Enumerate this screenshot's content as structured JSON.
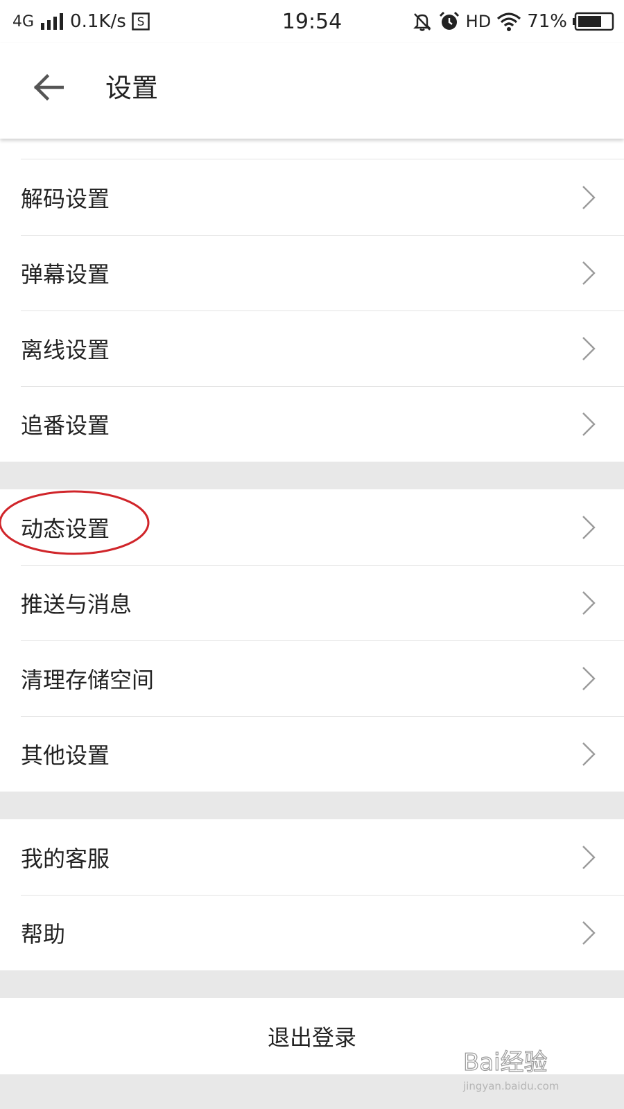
{
  "status_bar": {
    "network": "4G",
    "speed": "0.1K/s",
    "app_badge": "S",
    "time": "19:54",
    "hd": "HD",
    "battery": "71%",
    "battery_level": 0.71
  },
  "header": {
    "title": "设置",
    "back_icon": "arrow-left-icon"
  },
  "settings": {
    "group1": [
      {
        "label": "解码设置"
      },
      {
        "label": "弹幕设置"
      },
      {
        "label": "离线设置"
      },
      {
        "label": "追番设置"
      }
    ],
    "group2": [
      {
        "label": "动态设置"
      },
      {
        "label": "推送与消息"
      },
      {
        "label": "清理存储空间"
      },
      {
        "label": "其他设置"
      }
    ],
    "group3": [
      {
        "label": "我的客服"
      },
      {
        "label": "帮助"
      }
    ],
    "logout_label": "退出登录"
  },
  "watermark": {
    "brand": "Bai经验",
    "url": "jingyan.baidu.com"
  },
  "colors": {
    "annotation": "#d0252a",
    "separator": "#e2e2e2",
    "background": "#e8e8e8"
  }
}
